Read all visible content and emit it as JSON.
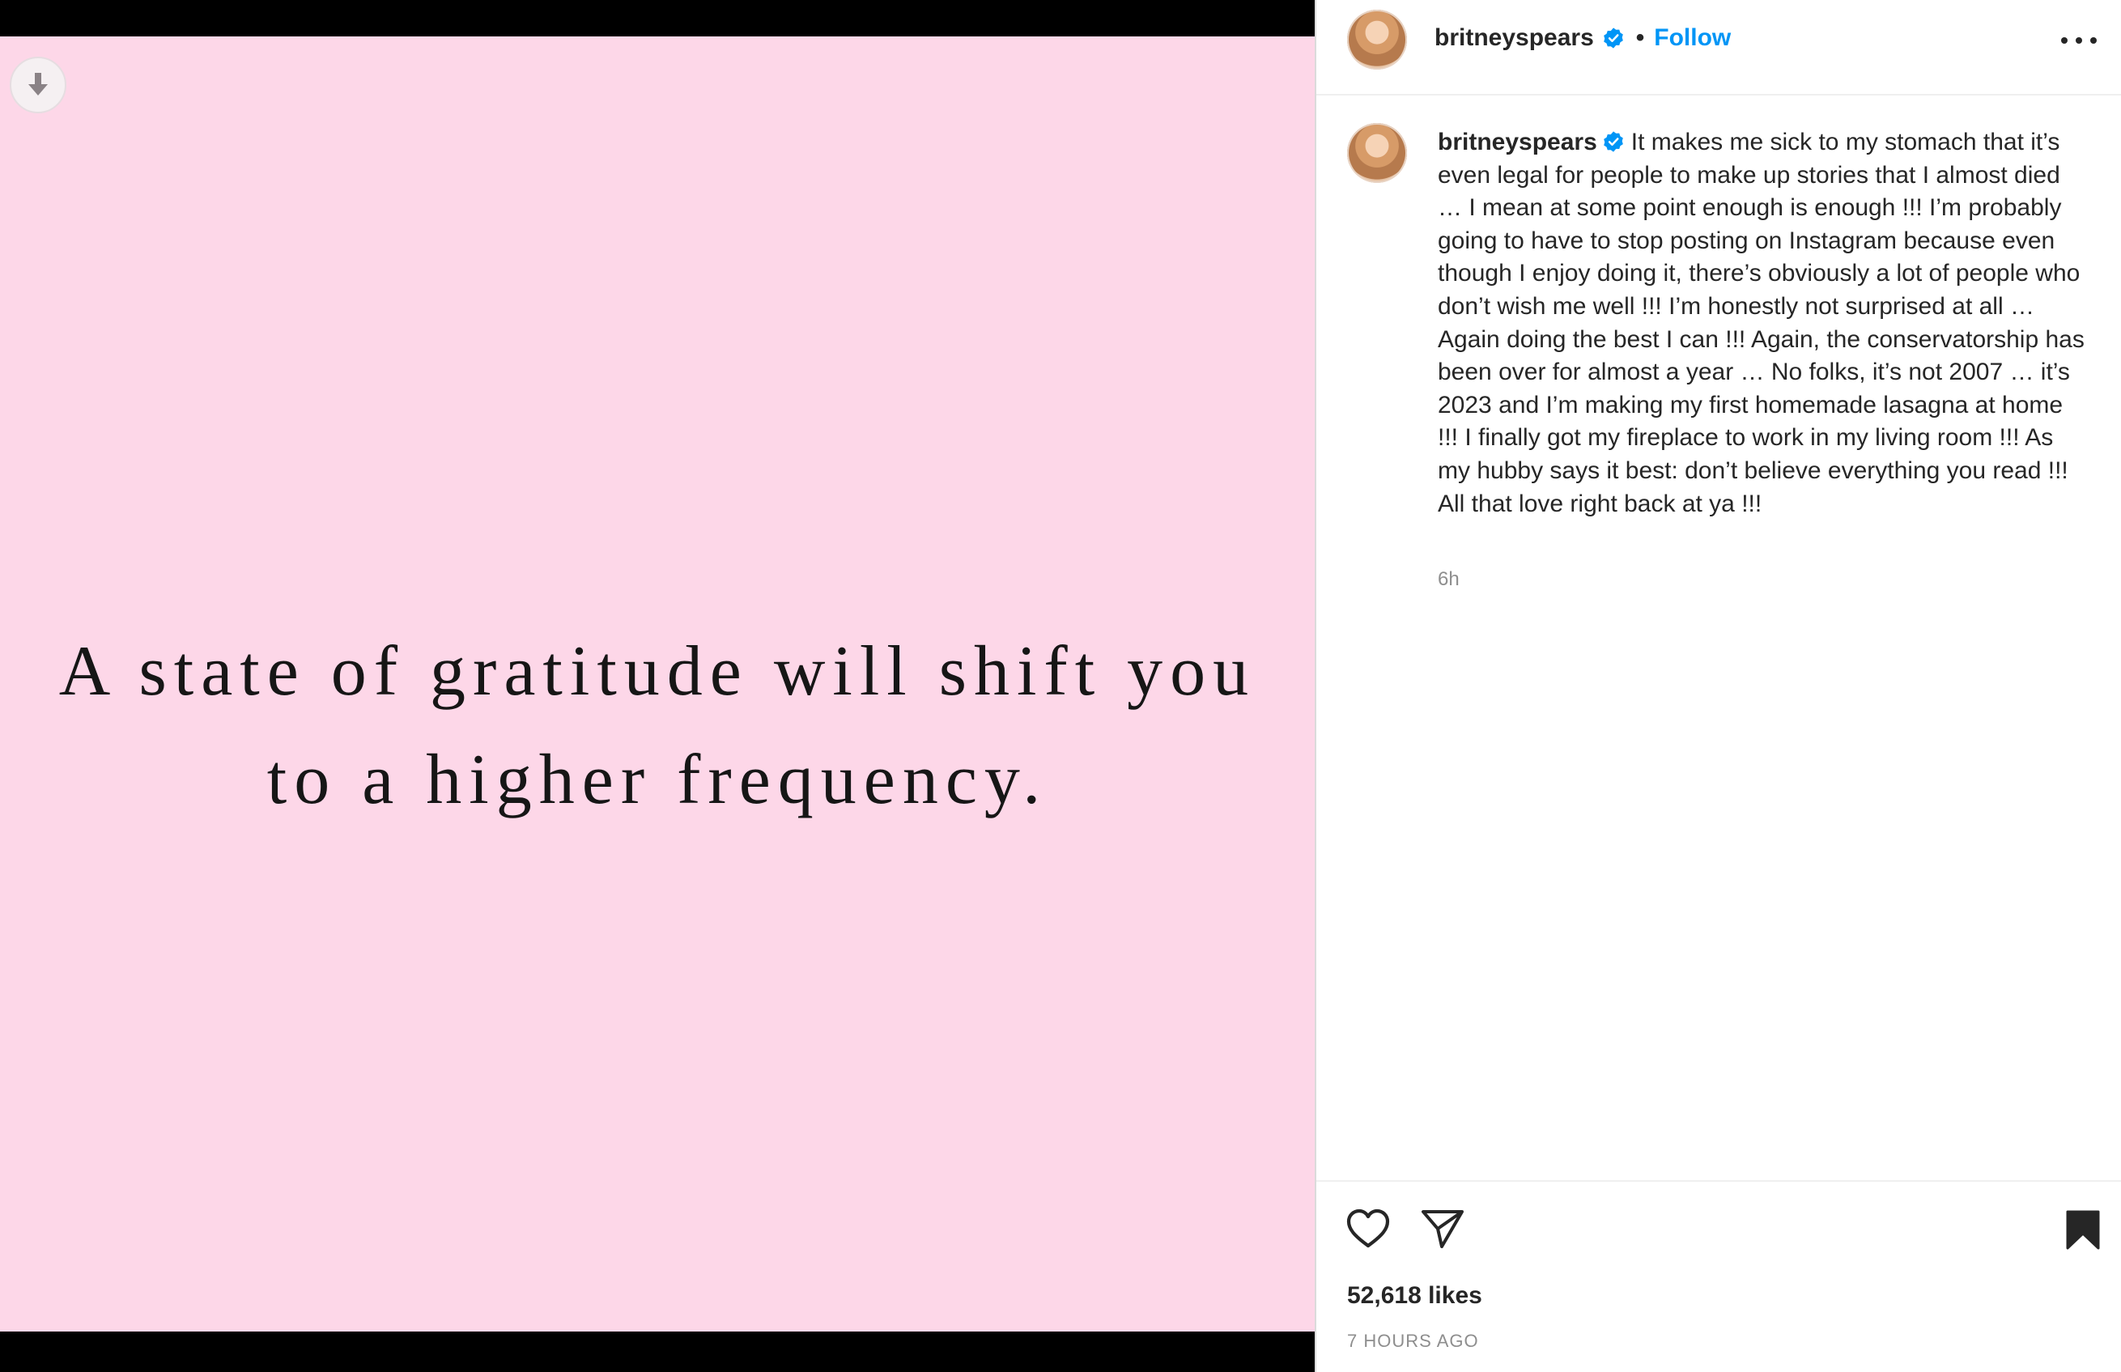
{
  "media": {
    "background_color": "#fdd7e8",
    "quote_lines": [
      "A state of gratitude will shift you",
      "to a higher frequency."
    ],
    "download_icon": "arrow-down-icon"
  },
  "header": {
    "username": "britneyspears",
    "separator": "•",
    "follow_label": "Follow",
    "verified_icon": "verified-badge-icon",
    "more_icon": "more-options-icon"
  },
  "caption": {
    "username": "britneyspears",
    "text": "It makes me sick to my stomach that it’s even legal for people to make up stories that I almost died … I mean at some point enough is enough !!! I’m probably going to have to stop posting on Instagram because even though I enjoy doing it, there’s obviously a lot of people who don’t wish me well !!! I’m honestly not surprised at all … Again doing the best I can !!! Again, the conservatorship has been over for almost a year … No folks, it’s not 2007 … it’s 2023 and I’m making my first homemade lasagna at home !!! I finally got my fireplace to work in my living room !!! As my hubby says it best: don’t believe everything you read !!! All that love right back at ya !!!",
    "time_short": "6h"
  },
  "actions": {
    "like_icon": "heart-icon",
    "share_icon": "send-icon",
    "save_icon": "bookmark-icon",
    "likes_text": "52,618 likes",
    "time_ago": "7 HOURS AGO"
  },
  "colors": {
    "accent": "#0095f6",
    "verified": "#0095f6",
    "muted": "#8e8e8e"
  }
}
